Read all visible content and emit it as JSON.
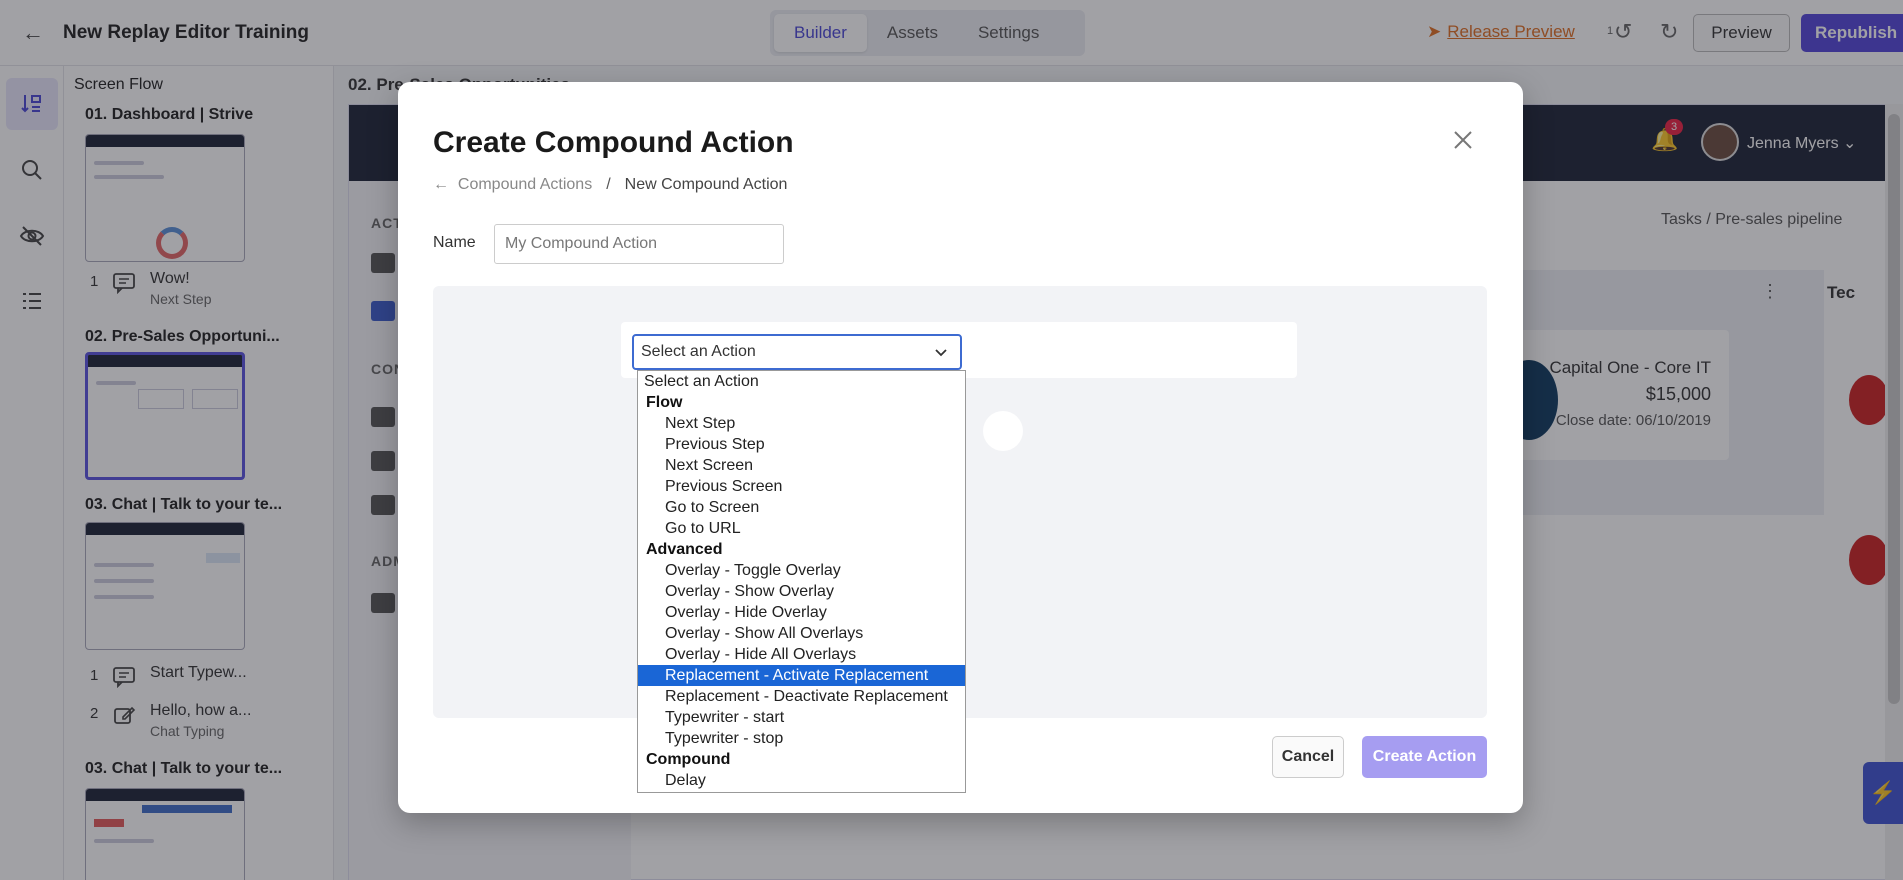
{
  "topbar": {
    "title": "New Replay Editor Training",
    "tabs": [
      {
        "label": "Builder",
        "active": true
      },
      {
        "label": "Assets",
        "active": false
      },
      {
        "label": "Settings",
        "active": false
      }
    ],
    "release_preview": "Release Preview",
    "undo_count": "1",
    "preview_label": "Preview",
    "republish_label": "Republish"
  },
  "rail": {
    "items": [
      "screen-flow-icon",
      "search-icon",
      "eye-off-icon",
      "list-tree-icon"
    ]
  },
  "flow": {
    "heading": "Screen Flow",
    "screens": [
      {
        "title": "01. Dashboard | Strive",
        "steps": [
          {
            "num": "1",
            "label": "Wow!",
            "sub": "Next Step"
          }
        ]
      },
      {
        "title": "02. Pre-Sales Opportuni...",
        "steps": []
      },
      {
        "title": "03. Chat | Talk to your te...",
        "steps": [
          {
            "num": "1",
            "label": "Start Typew...",
            "sub": ""
          },
          {
            "num": "2",
            "label": "Hello, how a...",
            "sub": "Chat Typing"
          }
        ]
      },
      {
        "title": "03. Chat | Talk to your te...",
        "steps": []
      }
    ]
  },
  "canvas": {
    "label": "02. Pre-Sales Opportunities",
    "notifications": "3",
    "user_name": "Jenna Myers",
    "side_sections": [
      "ACT",
      "CON",
      "ADM"
    ],
    "breadcrumb": "Tasks  /  Pre-sales pipeline",
    "deal": {
      "name": "Capital One - Core IT",
      "amount": "$15,000",
      "close_date": "Close date: 06/10/2019"
    },
    "column_title": "Tec"
  },
  "modal": {
    "title": "Create Compound Action",
    "breadcrumb_link": "Compound Actions",
    "breadcrumb_sep": "/",
    "breadcrumb_current": "New Compound Action",
    "name_label": "Name",
    "name_placeholder": "My Compound Action",
    "select_value": "Select an Action",
    "cancel_label": "Cancel",
    "create_label": "Create Action"
  },
  "dropdown": {
    "first": "Select an Action",
    "groups": [
      {
        "label": "Flow",
        "options": [
          "Next Step",
          "Previous Step",
          "Next Screen",
          "Previous Screen",
          "Go to Screen",
          "Go to URL"
        ]
      },
      {
        "label": "Advanced",
        "options": [
          "Overlay - Toggle Overlay",
          "Overlay - Show Overlay",
          "Overlay - Hide Overlay",
          "Overlay - Show All Overlays",
          "Overlay - Hide All Overlays",
          "Replacement - Activate Replacement",
          "Replacement - Deactivate Replacement",
          "Typewriter - start",
          "Typewriter - stop"
        ]
      },
      {
        "label": "Compound",
        "options": [
          "Delay"
        ]
      }
    ],
    "highlighted": "Replacement - Activate Replacement"
  },
  "colors": {
    "accent": "#5446d9",
    "release": "#e06f24",
    "highlight": "#1a66d6",
    "header_dark": "#1d2336"
  }
}
